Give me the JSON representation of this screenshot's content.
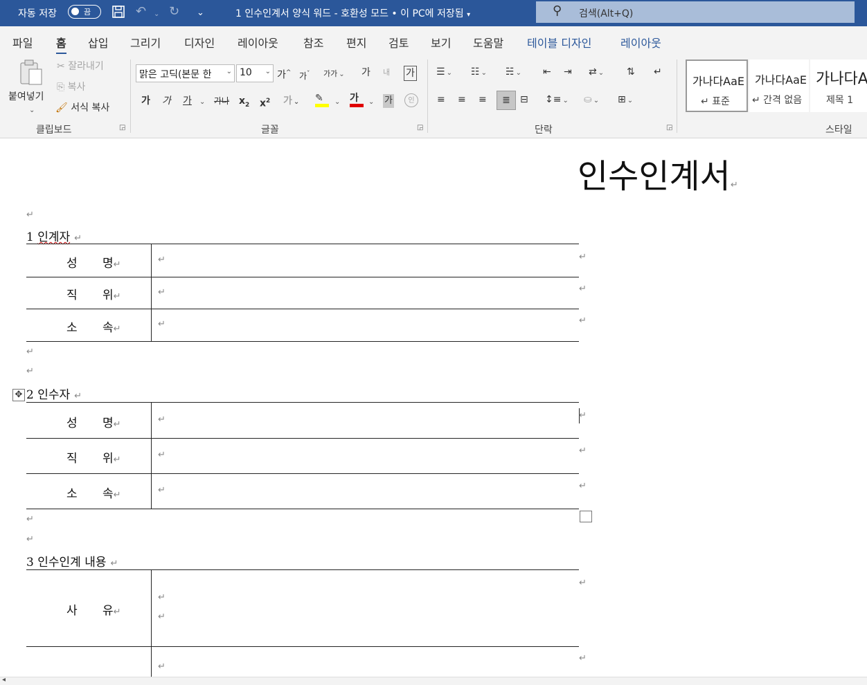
{
  "titlebar": {
    "autosave_label": "자동 저장",
    "autosave_state": "끔",
    "doc_title": "1 인수인계서 양식 워드  -  호환성 모드 • 이 PC에 저장됨",
    "search_placeholder": "검색(Alt+Q)"
  },
  "menu": [
    "파일",
    "홈",
    "삽입",
    "그리기",
    "디자인",
    "레이아웃",
    "참조",
    "편지",
    "검토",
    "보기",
    "도움말",
    "테이블 디자인",
    "레이아웃"
  ],
  "ribbon": {
    "clipboard": {
      "label": "클립보드",
      "paste": "붙여넣기",
      "cut": "잘라내기",
      "copy": "복사",
      "format_painter": "서식 복사"
    },
    "font": {
      "label": "글꼴",
      "font_name": "맑은 고딕(본문 한",
      "font_size": "10",
      "grow": "가",
      "shrink": "가",
      "case": "가가",
      "phonetic": "가",
      "clear": "내",
      "charbox": "가",
      "bold": "가",
      "italic": "가",
      "underline": "가",
      "strike": "가나",
      "sub": "x",
      "sup": "x",
      "effects": "가",
      "fontcolor": "가",
      "shade": "가",
      "enclose": "인"
    },
    "paragraph": {
      "label": "단락"
    },
    "styles": {
      "label": "스타일",
      "items": [
        {
          "preview": "가나다AaE",
          "name": "↵ 표준"
        },
        {
          "preview": "가나다AaE",
          "name": "↵ 간격 없음"
        },
        {
          "preview": "가나다A",
          "name": "제목 1"
        }
      ]
    }
  },
  "document": {
    "title": "인수인계서",
    "sections": [
      {
        "heading_num": "1",
        "heading": "인계자",
        "rows": [
          {
            "a": "성",
            "b": "명"
          },
          {
            "a": "직",
            "b": "위"
          },
          {
            "a": "소",
            "b": "속"
          }
        ]
      },
      {
        "heading_num": "2",
        "heading": "인수자",
        "rows": [
          {
            "a": "성",
            "b": "명"
          },
          {
            "a": "직",
            "b": "위"
          },
          {
            "a": "소",
            "b": "속"
          }
        ]
      },
      {
        "heading_num": "3",
        "heading": "인수인계 내용",
        "rows": [
          {
            "a": "사",
            "b": "유"
          }
        ]
      }
    ]
  },
  "colors": {
    "accent": "#2b579a",
    "highlight": "#ffff00",
    "font_color": "#e00000"
  }
}
